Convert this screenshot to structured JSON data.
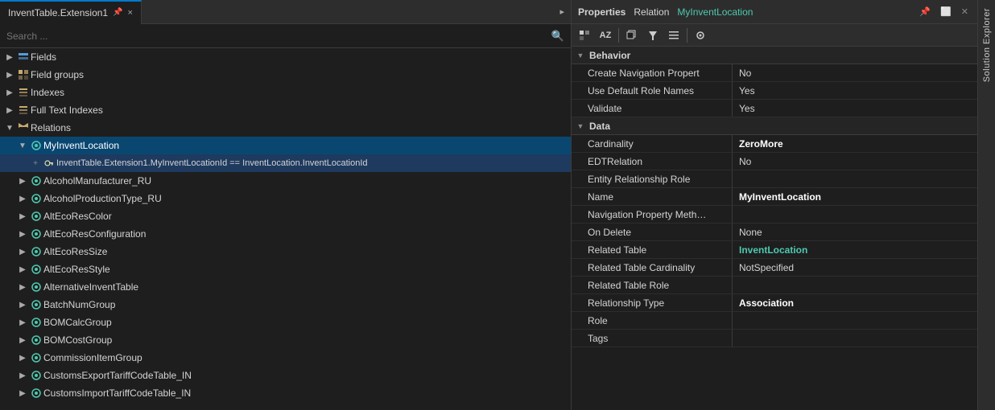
{
  "tab": {
    "title": "InventTable.Extension1",
    "close": "×",
    "pin": "▸"
  },
  "search": {
    "placeholder": "Search ..."
  },
  "tree": {
    "nodes": [
      {
        "id": "fields",
        "label": "Fields",
        "indent": 1,
        "expanded": false,
        "icon": "fields"
      },
      {
        "id": "fieldgroups",
        "label": "Field groups",
        "indent": 1,
        "expanded": false,
        "icon": "fieldgroups"
      },
      {
        "id": "indexes",
        "label": "Indexes",
        "indent": 1,
        "expanded": false,
        "icon": "indexes"
      },
      {
        "id": "fulltextindexes",
        "label": "Full Text Indexes",
        "indent": 1,
        "expanded": false,
        "icon": "indexes"
      },
      {
        "id": "relations",
        "label": "Relations",
        "indent": 1,
        "expanded": true,
        "icon": "relations"
      },
      {
        "id": "myinventlocation",
        "label": "MyInventLocation",
        "indent": 2,
        "expanded": true,
        "icon": "relation-item",
        "selected": true
      },
      {
        "id": "inventlocationid_eq",
        "label": "InventTable.Extension1.MyInventLocationId == InventLocation.InventLocationId",
        "indent": 3,
        "icon": "key",
        "selected": false,
        "isChild": true
      },
      {
        "id": "alcoholmanufacturer",
        "label": "AlcoholManufacturer_RU",
        "indent": 2,
        "icon": "relation-item",
        "selected": false
      },
      {
        "id": "alcoholproductiontype",
        "label": "AlcoholProductionType_RU",
        "indent": 2,
        "icon": "relation-item",
        "selected": false
      },
      {
        "id": "altecorescolor",
        "label": "AltEcoResColor",
        "indent": 2,
        "icon": "relation-item",
        "selected": false
      },
      {
        "id": "altecoresconfig",
        "label": "AltEcoResConfiguration",
        "indent": 2,
        "icon": "relation-item",
        "selected": false
      },
      {
        "id": "altecoressize",
        "label": "AltEcoResSize",
        "indent": 2,
        "icon": "relation-item",
        "selected": false
      },
      {
        "id": "altecoresstyle",
        "label": "AltEcoResStyle",
        "indent": 2,
        "icon": "relation-item",
        "selected": false
      },
      {
        "id": "alternativeinventtable",
        "label": "AlternativeInventTable",
        "indent": 2,
        "icon": "relation-item",
        "selected": false
      },
      {
        "id": "batchnumgroup",
        "label": "BatchNumGroup",
        "indent": 2,
        "icon": "relation-item",
        "selected": false
      },
      {
        "id": "bomcalcgroup",
        "label": "BOMCalcGroup",
        "indent": 2,
        "icon": "relation-item",
        "selected": false
      },
      {
        "id": "bomcostgroup",
        "label": "BOMCostGroup",
        "indent": 2,
        "icon": "relation-item",
        "selected": false
      },
      {
        "id": "commissionitemgroup",
        "label": "CommissionItemGroup",
        "indent": 2,
        "icon": "relation-item",
        "selected": false
      },
      {
        "id": "customsexporttariff",
        "label": "CustomsExportTariffCodeTable_IN",
        "indent": 2,
        "icon": "relation-item",
        "selected": false
      },
      {
        "id": "customsimporttariff",
        "label": "CustomsImportTariffCodeTable_IN",
        "indent": 2,
        "icon": "relation-item",
        "selected": false
      }
    ]
  },
  "properties": {
    "title": "Properties",
    "relation_label": "Relation",
    "relation_value": "MyInventLocation",
    "toolbar_buttons": [
      "grid-icon",
      "az-icon",
      "categorized-icon",
      "filter-icon",
      "page-icon",
      "wrench-icon"
    ],
    "sections": [
      {
        "name": "Behavior",
        "collapsed": false,
        "rows": [
          {
            "name": "Create Navigation Propert",
            "value": "No",
            "bold": false
          },
          {
            "name": "Use Default Role Names",
            "value": "Yes",
            "bold": false
          },
          {
            "name": "Validate",
            "value": "Yes",
            "bold": false
          }
        ]
      },
      {
        "name": "Data",
        "collapsed": false,
        "rows": [
          {
            "name": "Cardinality",
            "value": "ZeroMore",
            "bold": true
          },
          {
            "name": "EDTRelation",
            "value": "No",
            "bold": false
          },
          {
            "name": "Entity Relationship Role",
            "value": "",
            "bold": false
          },
          {
            "name": "Name",
            "value": "MyInventLocation",
            "bold": true
          },
          {
            "name": "Navigation Property Meth…",
            "value": "",
            "bold": false
          },
          {
            "name": "On Delete",
            "value": "None",
            "bold": false
          },
          {
            "name": "Related Table",
            "value": "InventLocation",
            "bold": true,
            "accent": true
          },
          {
            "name": "Related Table Cardinality",
            "value": "NotSpecified",
            "bold": false
          },
          {
            "name": "Related Table Role",
            "value": "",
            "bold": false
          },
          {
            "name": "Relationship Type",
            "value": "Association",
            "bold": true
          },
          {
            "name": "Role",
            "value": "",
            "bold": false
          },
          {
            "name": "Tags",
            "value": "",
            "bold": false
          }
        ]
      }
    ]
  },
  "sidebar": {
    "label": "Solution Explorer"
  }
}
